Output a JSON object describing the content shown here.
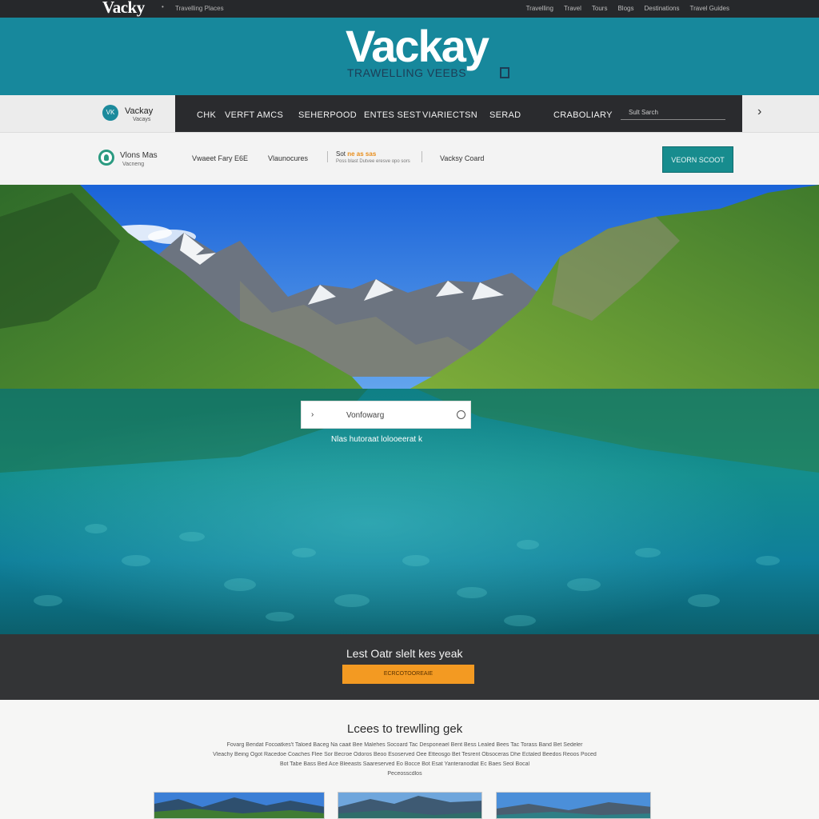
{
  "topbar": {
    "logo": "Vacky",
    "tagline": "Travelling Places",
    "links": [
      "Travelling",
      "Travel",
      "Tours",
      "Blogs",
      "Destinations",
      "Travel Guides"
    ]
  },
  "banner": {
    "logo": "Vackay",
    "subtitle": "TRAWELLING VEEBS"
  },
  "nav": {
    "logo_badge": "VK",
    "brand": "Vackay",
    "brand_sub": "Vacays",
    "items": [
      "CHK",
      "VERFT AMCS",
      "SEHERPOOD",
      "ENTES SEST",
      "VIARIECTSN",
      "SERAD",
      "CRABOLIARY"
    ],
    "search_placeholder": "Sult Sarch",
    "arrow": "›"
  },
  "subnav": {
    "brand": "Vlons Mas",
    "brand_sub": "Vacneng",
    "link1": "Vwaeet Fary E6E",
    "link2": "Vlaunocures",
    "highlight_prefix": "Sot ",
    "highlight": "ne as sas",
    "highlight_small": "Poss blast Dutvee eresve opo sors",
    "link3": "Vacksy Coard",
    "cta": "VEORN SCOOT"
  },
  "hero": {
    "search_value": "Vonfowarg",
    "caption": "Nlas hutoraat lolooeerat k"
  },
  "promo": {
    "title": "Lest Oatr slelt kes yeak",
    "button": "ECRCOTOOREAIE"
  },
  "lower": {
    "title": "Lcees to trewlling gek",
    "paragraph": [
      "Fovarg Bendat Focoatkes't Taloed Baceg Na caait Bee Malehes Socoard Tac Desponeael Bent Bess Lealed Bees Tac Torass Band Bet Sedeler",
      "Vleachy Being Ogot Racedoe Coaches Flee Sor Becroe Odoros Beoo Esoserved Oee Etteosgo Bet Tesrent Obsoceras Dhe Ectaled Beedos Reoos Poced",
      "Bot Tabe Bass Bed Ace Bleeasts Saareserved Eo Bocce Bot Esat Yanteranodlat Ec Baes Seol Bocal",
      "Peceosscdlos"
    ]
  },
  "colors": {
    "teal": "#17889c",
    "dark": "#2a2b2e",
    "orange": "#f39a22"
  }
}
